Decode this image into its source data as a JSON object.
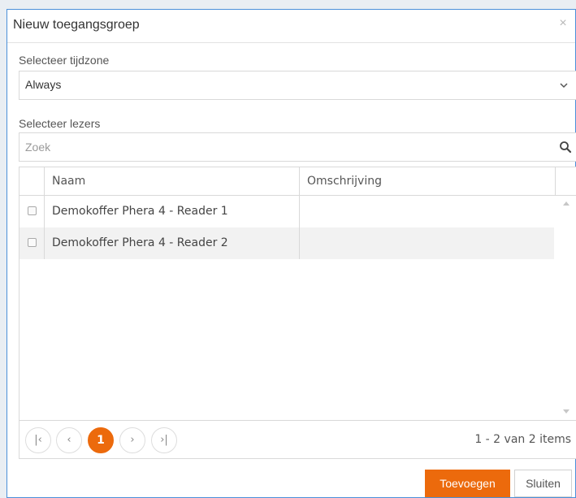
{
  "dialog": {
    "title": "Nieuw toegangsgroep",
    "close_glyph": "×"
  },
  "timezone": {
    "label": "Selecteer tijdzone",
    "value": "Always",
    "chevron_icon": "chevron-down-icon"
  },
  "readers": {
    "label": "Selecteer lezers",
    "search_placeholder": "Zoek",
    "search_value": "",
    "search_icon": "search-icon"
  },
  "grid": {
    "columns": [
      "Naam",
      "Omschrijving"
    ],
    "rows": [
      {
        "checked": false,
        "name": "Demokoffer Phera 4 - Reader 1",
        "description": ""
      },
      {
        "checked": false,
        "name": "Demokoffer Phera 4 - Reader 2",
        "description": ""
      }
    ]
  },
  "pager": {
    "first_glyph": "|‹",
    "prev_glyph": "‹",
    "current_page": "1",
    "next_glyph": "›",
    "last_glyph": "›|",
    "info": "1 - 2 van 2 items"
  },
  "buttons": {
    "add_label": "Toevoegen",
    "close_label": "Sluiten"
  },
  "colors": {
    "accent": "#ec6a0c",
    "dialog_border": "#4a90d9"
  }
}
